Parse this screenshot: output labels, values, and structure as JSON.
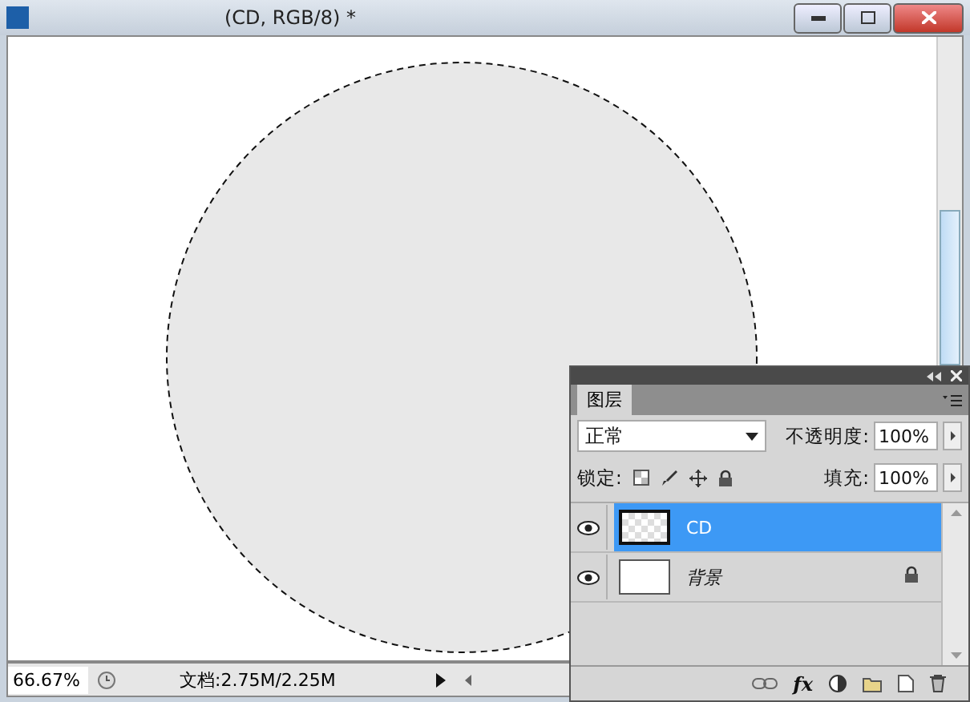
{
  "window": {
    "title": "(CD, RGB/8) *"
  },
  "status_bar": {
    "zoom": "66.67%",
    "doc_info": "文档:2.75M/2.25M"
  },
  "layers_panel": {
    "tab": {
      "label": "图层",
      "selected": true
    },
    "blend_mode": "正常",
    "opacity_label": "不透明度:",
    "opacity": "100%",
    "lock_label": "锁定:",
    "fill_label": "填充:",
    "fill": "100%",
    "layers": [
      {
        "name": "CD",
        "selected": true,
        "visible": true,
        "locked": false,
        "kind": "transparent"
      },
      {
        "name": "背景",
        "selected": false,
        "visible": true,
        "locked": true,
        "kind": "white"
      }
    ],
    "fx_label": "fx"
  }
}
